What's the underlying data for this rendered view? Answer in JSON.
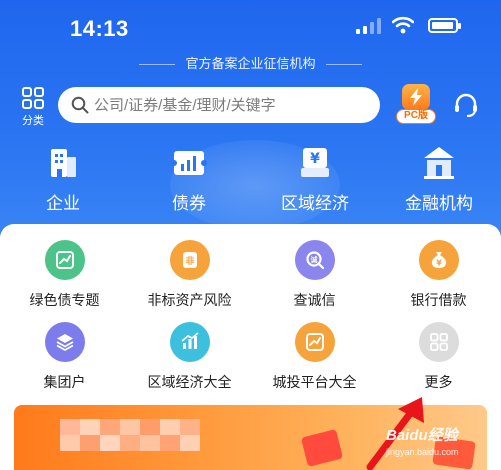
{
  "status_bar": {
    "time": "14:13"
  },
  "header": {
    "tagline": "官方备案企业征信机构",
    "category_label": "分类",
    "search_placeholder": "公司/证券/基金/理财/关键字",
    "pc_badge": "PC版"
  },
  "main_nav": [
    {
      "label": "企业",
      "icon": "building-icon"
    },
    {
      "label": "债券",
      "icon": "bond-chart-icon"
    },
    {
      "label": "区域经济",
      "icon": "yen-shop-icon"
    },
    {
      "label": "金融机构",
      "icon": "bank-icon"
    }
  ],
  "service_grid": [
    {
      "label": "绿色债专题",
      "icon": "green-bond-icon",
      "color": "#4cc389"
    },
    {
      "label": "非标资产风险",
      "icon": "nonstandard-asset-icon",
      "color": "#f6a33c"
    },
    {
      "label": "查诚信",
      "icon": "credit-check-icon",
      "color": "#8b86ee"
    },
    {
      "label": "银行借款",
      "icon": "money-bag-icon",
      "color": "#f6a33c"
    },
    {
      "label": "集团户",
      "icon": "layers-icon",
      "color": "#7c7cec"
    },
    {
      "label": "区域经济大全",
      "icon": "region-chart-icon",
      "color": "#3cc0de"
    },
    {
      "label": "城投平台大全",
      "icon": "platform-chart-icon",
      "color": "#f6a33c"
    },
    {
      "label": "更多",
      "icon": "more-grid-icon",
      "color": "#d6d6d6"
    }
  ],
  "watermark": {
    "brand": "Baidu经验",
    "url": "jingyan.baidu.com"
  },
  "colors": {
    "primary": "#2a75f2",
    "accent_orange": "#ff7a1a"
  }
}
